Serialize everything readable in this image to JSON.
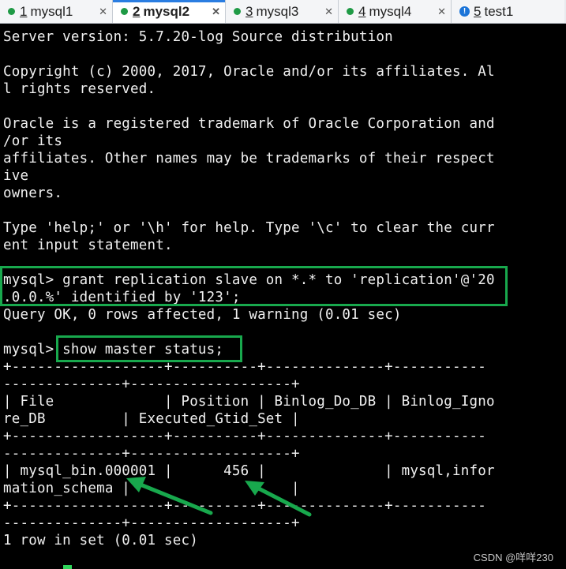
{
  "tabs": [
    {
      "num": "1",
      "label": "mysql1",
      "active": false,
      "icon": "dot-icon"
    },
    {
      "num": "2",
      "label": "mysql2",
      "active": true,
      "icon": "dot-icon"
    },
    {
      "num": "3",
      "label": "mysql3",
      "active": false,
      "icon": "dot-icon"
    },
    {
      "num": "4",
      "label": "mysql4",
      "active": false,
      "icon": "dot-icon"
    },
    {
      "num": "5",
      "label": "test1",
      "active": false,
      "icon": "info-icon"
    }
  ],
  "tab_close_glyph": "✕",
  "terminal": {
    "lines": [
      "Server version: 5.7.20-log Source distribution",
      "",
      "Copyright (c) 2000, 2017, Oracle and/or its affiliates. Al",
      "l rights reserved.",
      "",
      "Oracle is a registered trademark of Oracle Corporation and",
      "/or its",
      "affiliates. Other names may be trademarks of their respect",
      "ive",
      "owners.",
      "",
      "Type 'help;' or '\\h' for help. Type '\\c' to clear the curr",
      "ent input statement.",
      "",
      "mysql> grant replication slave on *.* to 'replication'@'20",
      ".0.0.%' identified by '123';",
      "Query OK, 0 rows affected, 1 warning (0.01 sec)",
      "",
      "mysql> show master status;",
      "+------------------+----------+--------------+-----------",
      "--------------+-------------------+",
      "| File             | Position | Binlog_Do_DB | Binlog_Igno",
      "re_DB         | Executed_Gtid_Set |",
      "+------------------+----------+--------------+-----------",
      "--------------+-------------------+",
      "| mysql_bin.000001 |      456 |              | mysql,infor",
      "mation_schema |                   |",
      "+------------------+----------+--------------+-----------",
      "--------------+-------------------+",
      "1 row in set (0.01 sec)"
    ]
  },
  "watermark": "CSDN @咩咩230",
  "colors": {
    "terminal_bg": "#000000",
    "terminal_fg": "#f0f0f0",
    "highlight": "#18a84d",
    "active_tab_accent": "#2a7de1",
    "status_dot": "#1f9a45"
  }
}
